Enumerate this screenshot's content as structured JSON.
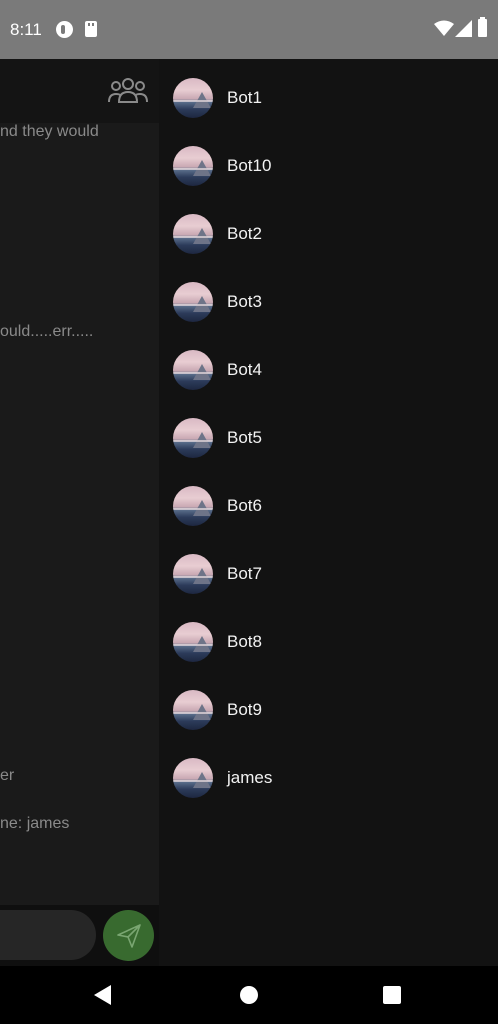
{
  "status_bar": {
    "time": "8:11"
  },
  "chat": {
    "messages": [
      "nd they would",
      "ould.....err.....",
      "er",
      "ne: james"
    ],
    "input_placeholder": ""
  },
  "drawer": {
    "users": [
      {
        "name": "Bot1"
      },
      {
        "name": "Bot10"
      },
      {
        "name": "Bot2"
      },
      {
        "name": "Bot3"
      },
      {
        "name": "Bot4"
      },
      {
        "name": "Bot5"
      },
      {
        "name": "Bot6"
      },
      {
        "name": "Bot7"
      },
      {
        "name": "Bot8"
      },
      {
        "name": "Bot9"
      },
      {
        "name": "james"
      }
    ]
  },
  "icons": {
    "group": "group-icon",
    "send": "send-icon",
    "back": "back-icon",
    "home": "home-icon",
    "recents": "recents-icon"
  },
  "colors": {
    "drawer_bg": "#121212",
    "send_button": "#386a2f",
    "status_bar": "#7a7a7a"
  }
}
